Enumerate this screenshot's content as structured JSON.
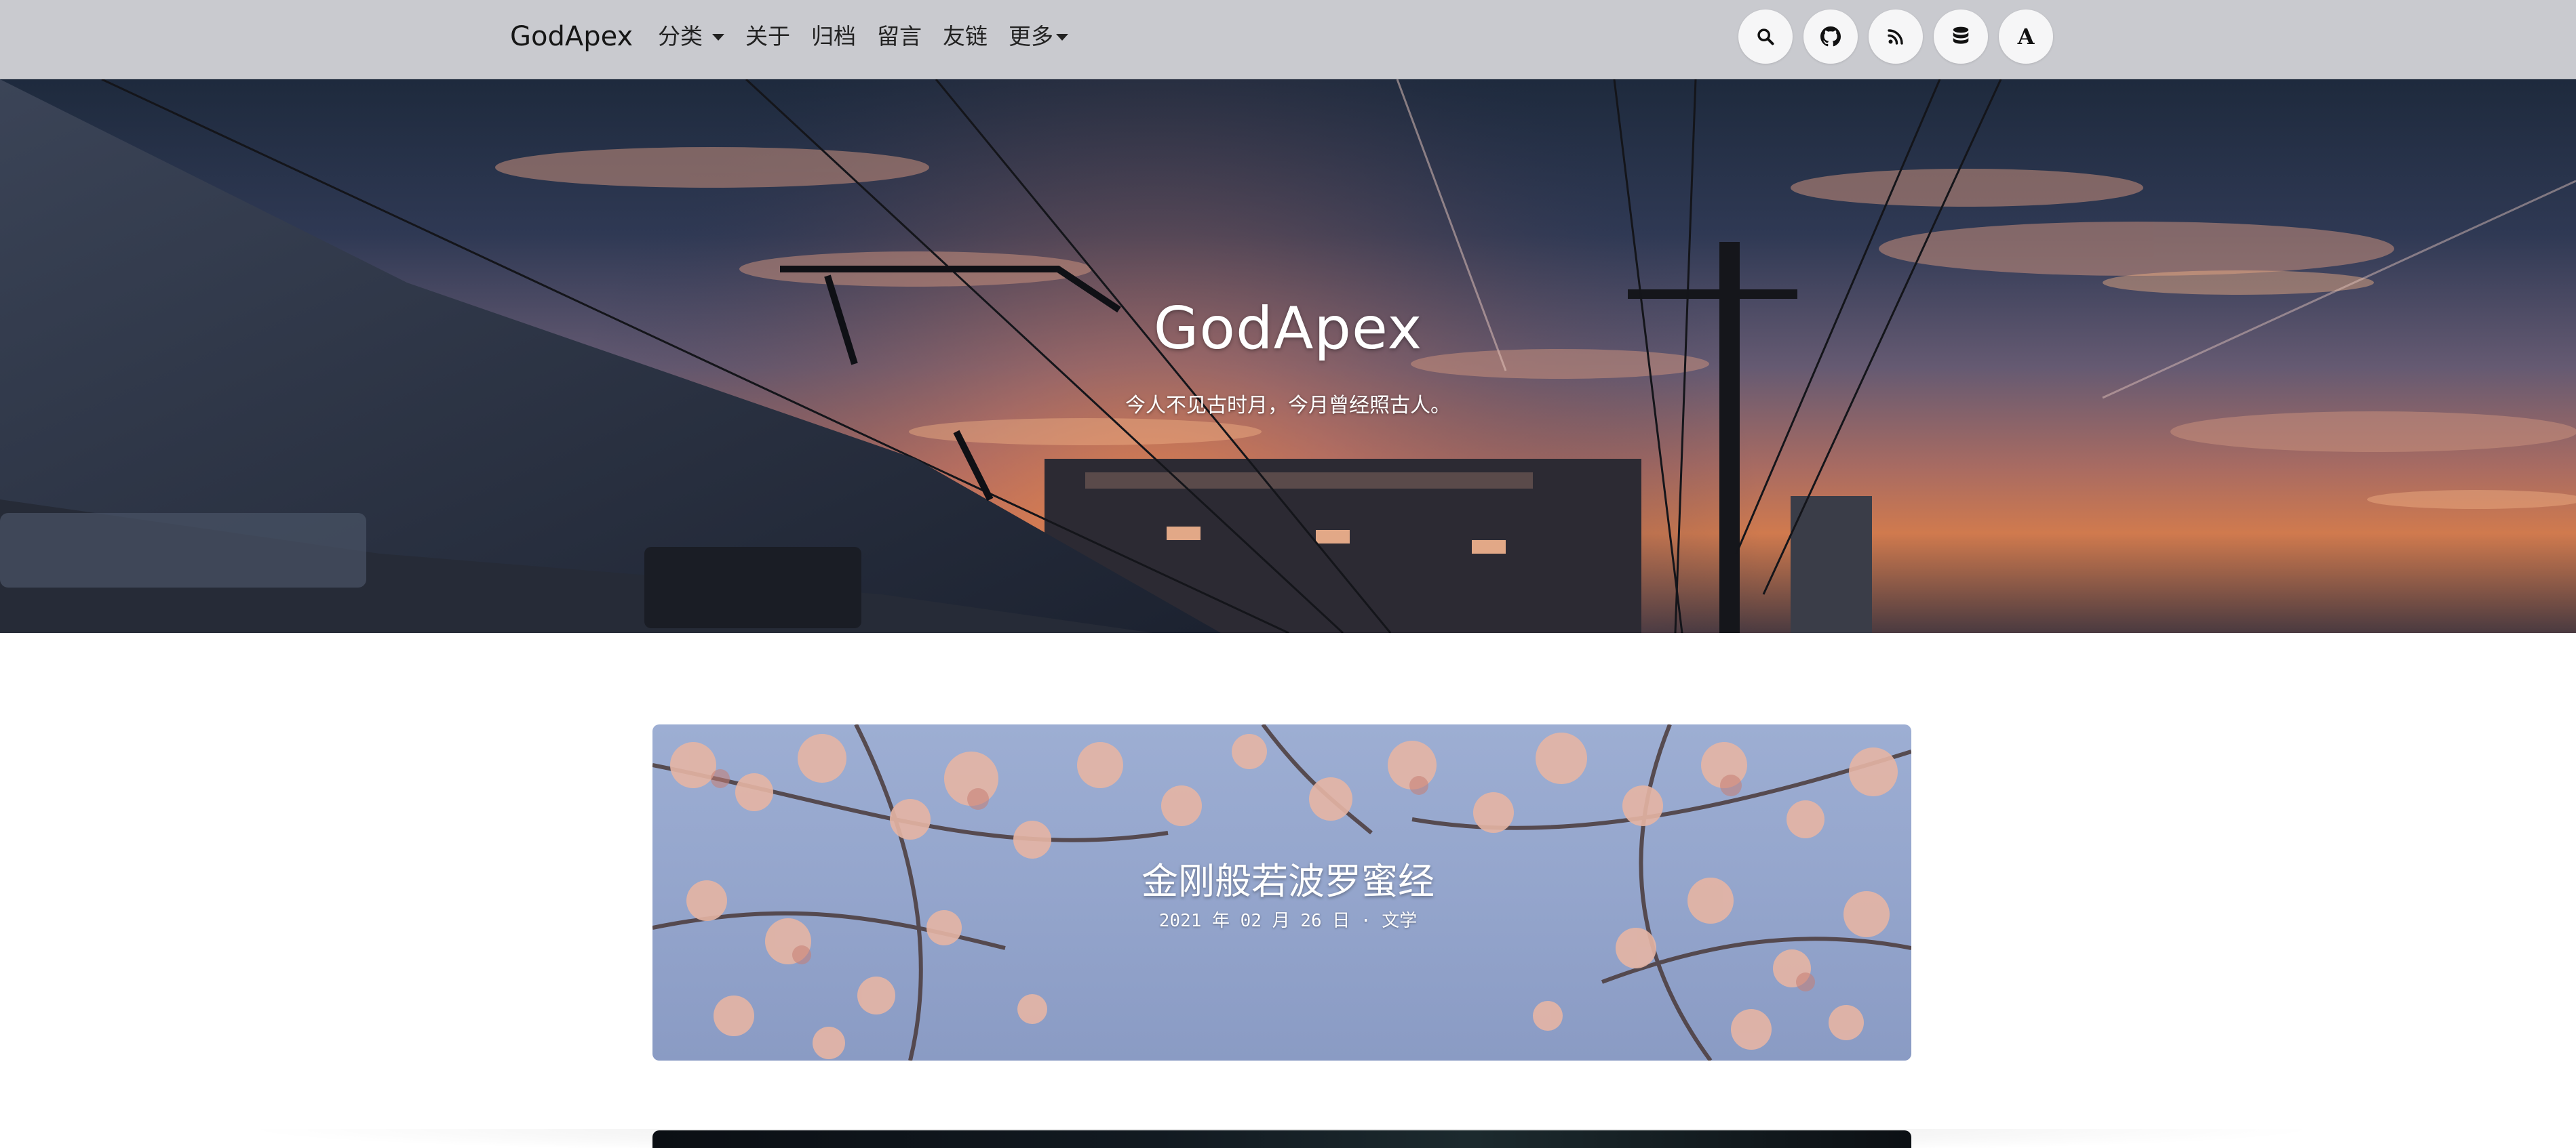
{
  "navbar": {
    "brand": "GodApex",
    "items": [
      {
        "label": "分类",
        "dropdown": true
      },
      {
        "label": "关于",
        "dropdown": false
      },
      {
        "label": "归档",
        "dropdown": false
      },
      {
        "label": "留言",
        "dropdown": false
      },
      {
        "label": "友链",
        "dropdown": false
      },
      {
        "label": "更多",
        "dropdown": true
      }
    ],
    "icons": [
      "search-icon",
      "github-icon",
      "rss-icon",
      "database-icon",
      "font-icon"
    ],
    "font_icon_glyph": "A"
  },
  "hero": {
    "title": "GodApex",
    "subtitle": "今人不见古时月，今月曾经照古人。"
  },
  "posts": [
    {
      "title": "金刚般若波罗蜜经",
      "meta": "2021 年 02 月 26 日 · 文学"
    }
  ],
  "colors": {
    "navbar_bg": "#c9cacf",
    "page_bg": "#ffffff",
    "text_dark": "#161616",
    "text_light": "#ffffff"
  }
}
